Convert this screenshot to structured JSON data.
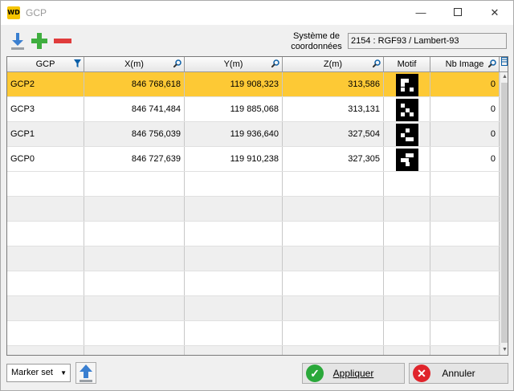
{
  "window": {
    "app_icon_text": "WD",
    "title": "GCP",
    "min_glyph": "—",
    "close_glyph": "✕"
  },
  "toolbar": {
    "import_icon": "download-arrow-icon",
    "add_icon": "plus-icon",
    "remove_icon": "minus-icon",
    "coord_label_line1": "Système de",
    "coord_label_line2": "coordonnées",
    "coord_value": "2154 : RGF93 / Lambert-93"
  },
  "grid": {
    "columns": [
      "GCP",
      "X(m)",
      "Y(m)",
      "Z(m)",
      "Motif",
      "Nb Image"
    ],
    "rows": [
      {
        "gcp": "GCP2",
        "x": "846 768,618",
        "y": "119 908,323",
        "z": "313,586",
        "nb": "0",
        "selected": true
      },
      {
        "gcp": "GCP3",
        "x": "846 741,484",
        "y": "119 885,068",
        "z": "313,131",
        "nb": "0",
        "selected": false
      },
      {
        "gcp": "GCP1",
        "x": "846 756,039",
        "y": "119 936,640",
        "z": "327,504",
        "nb": "0",
        "selected": false
      },
      {
        "gcp": "GCP0",
        "x": "846 727,639",
        "y": "119 910,238",
        "z": "327,305",
        "nb": "0",
        "selected": false
      }
    ]
  },
  "bottom": {
    "marker_set_label": "Marker set",
    "apply_label": "Appliquer",
    "cancel_label": "Annuler"
  },
  "colors": {
    "selected_row": "#fdc935",
    "accent_blue": "#0a5fa8",
    "apply_green": "#2aa83a",
    "cancel_red": "#e0242b"
  }
}
